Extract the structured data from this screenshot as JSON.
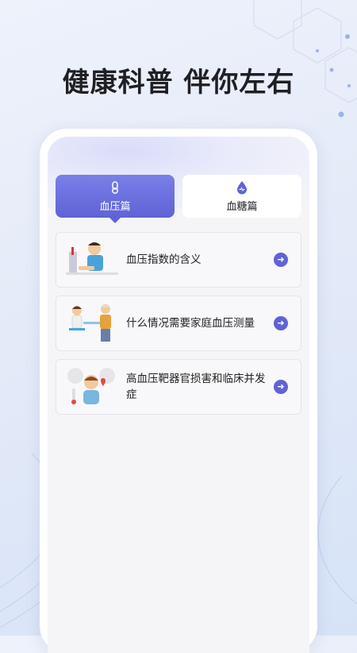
{
  "headline": "健康科普 伴你左右",
  "tabs": [
    {
      "label": "血压篇",
      "icon": "blood-pressure-icon",
      "active": true
    },
    {
      "label": "血糖篇",
      "icon": "blood-sugar-icon",
      "active": false
    }
  ],
  "articles": [
    {
      "title": "血压指数的含义",
      "illustration": "doctor-measuring-bp-illustration"
    },
    {
      "title": "什么情况需要家庭血压测量",
      "illustration": "home-bp-measurement-illustration"
    },
    {
      "title": "高血压靶器官损害和临床并发症",
      "illustration": "fever-patient-illustration"
    }
  ],
  "colors": {
    "accent": "#5f63d6",
    "accent_light": "#7a7fe8",
    "headline": "#1f1f24"
  }
}
